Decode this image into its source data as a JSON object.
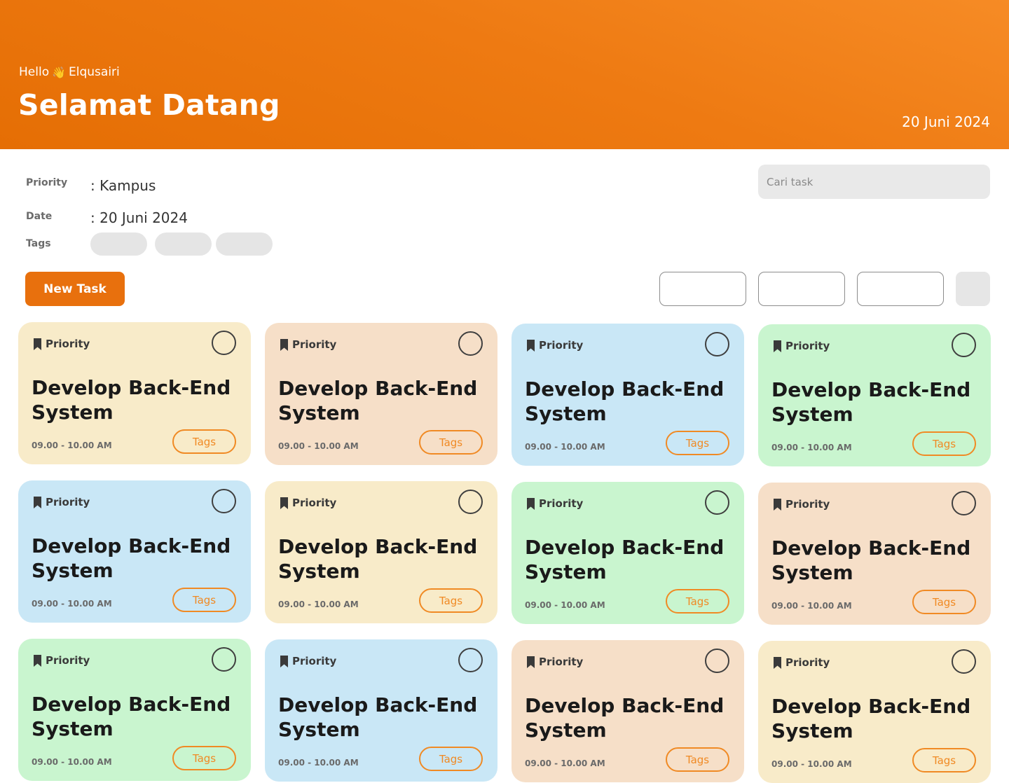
{
  "header": {
    "greeting_hello": "Hello",
    "greeting_name": "Elqusairi",
    "title": "Selamat Datang",
    "date": "20 Juni 2024"
  },
  "meta": {
    "priority_label": "Priority",
    "priority_value": ": Kampus",
    "date_label": "Date",
    "date_value": ": 20 Juni 2024",
    "tags_label": "Tags"
  },
  "search": {
    "placeholder": "Cari task",
    "value": ""
  },
  "toolbar": {
    "new_task_label": "New Task"
  },
  "colors": {
    "accent": "#e8700d",
    "yellow": "#f8ebc9",
    "peach": "#f6dfc8",
    "blue": "#c9e7f6",
    "green": "#c9f5cf"
  },
  "cards": [
    {
      "priority": "Priority",
      "title": "Develop Back-End System",
      "time": "09.00 - 10.00  AM",
      "tag": "Tags",
      "color": "#f8ebc9"
    },
    {
      "priority": "Priority",
      "title": "Develop Back-End System",
      "time": "09.00 - 10.00  AM",
      "tag": "Tags",
      "color": "#f6dfc8"
    },
    {
      "priority": "Priority",
      "title": "Develop Back-End System",
      "time": "09.00 - 10.00  AM",
      "tag": "Tags",
      "color": "#c9e7f6"
    },
    {
      "priority": "Priority",
      "title": "Develop Back-End System",
      "time": "09.00 - 10.00  AM",
      "tag": "Tags",
      "color": "#c9f5cf"
    },
    {
      "priority": "Priority",
      "title": "Develop Back-End System",
      "time": "09.00 - 10.00  AM",
      "tag": "Tags",
      "color": "#c9e7f6"
    },
    {
      "priority": "Priority",
      "title": "Develop Back-End System",
      "time": "09.00 - 10.00  AM",
      "tag": "Tags",
      "color": "#f8ebc9"
    },
    {
      "priority": "Priority",
      "title": "Develop Back-End System",
      "time": "09.00 - 10.00  AM",
      "tag": "Tags",
      "color": "#c9f5cf"
    },
    {
      "priority": "Priority",
      "title": "Develop Back-End System",
      "time": "09.00 - 10.00  AM",
      "tag": "Tags",
      "color": "#f6dfc8"
    },
    {
      "priority": "Priority",
      "title": "Develop Back-End System",
      "time": "09.00 - 10.00  AM",
      "tag": "Tags",
      "color": "#c9f5cf"
    },
    {
      "priority": "Priority",
      "title": "Develop Back-End System",
      "time": "09.00 - 10.00  AM",
      "tag": "Tags",
      "color": "#c9e7f6"
    },
    {
      "priority": "Priority",
      "title": "Develop Back-End System",
      "time": "09.00 - 10.00  AM",
      "tag": "Tags",
      "color": "#f6dfc8"
    },
    {
      "priority": "Priority",
      "title": "Develop Back-End System",
      "time": "09.00 - 10.00  AM",
      "tag": "Tags",
      "color": "#f8ebc9"
    }
  ]
}
